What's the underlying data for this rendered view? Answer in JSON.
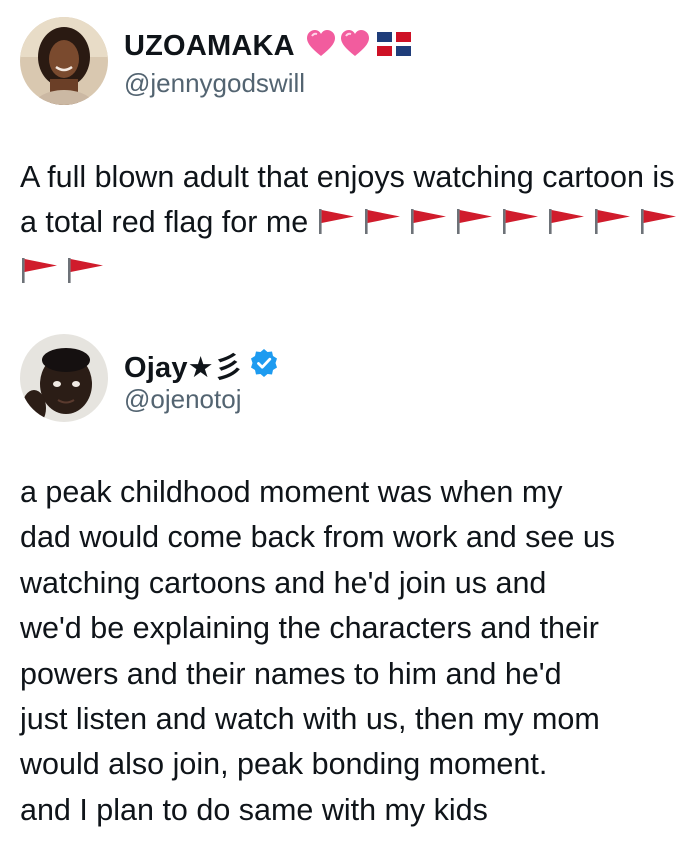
{
  "tweet1": {
    "display_name": "UZOAMAKA",
    "handle": "@jennygodswill",
    "text": "A full blown adult that enjoys watching cartoon is a total red flag for me",
    "emojis": [
      "heart-icon",
      "heart-icon",
      "dominican-flag-icon"
    ],
    "red_flag_count": 10,
    "red_flag_color": "#d01c2c"
  },
  "tweet2": {
    "display_name": "Ojay★彡",
    "handle": "@ojenotoj",
    "verified_color": "#1d9bf0",
    "lines": [
      "a peak childhood moment was when my",
      "dad would come back from work and see us",
      "watching cartoons and he'd join us and",
      "we'd be explaining the characters and their",
      "powers and their names to him and he'd",
      "just listen and watch with us, then my mom",
      "would also join, peak bonding moment.",
      "and I plan to do same with my kids"
    ]
  }
}
